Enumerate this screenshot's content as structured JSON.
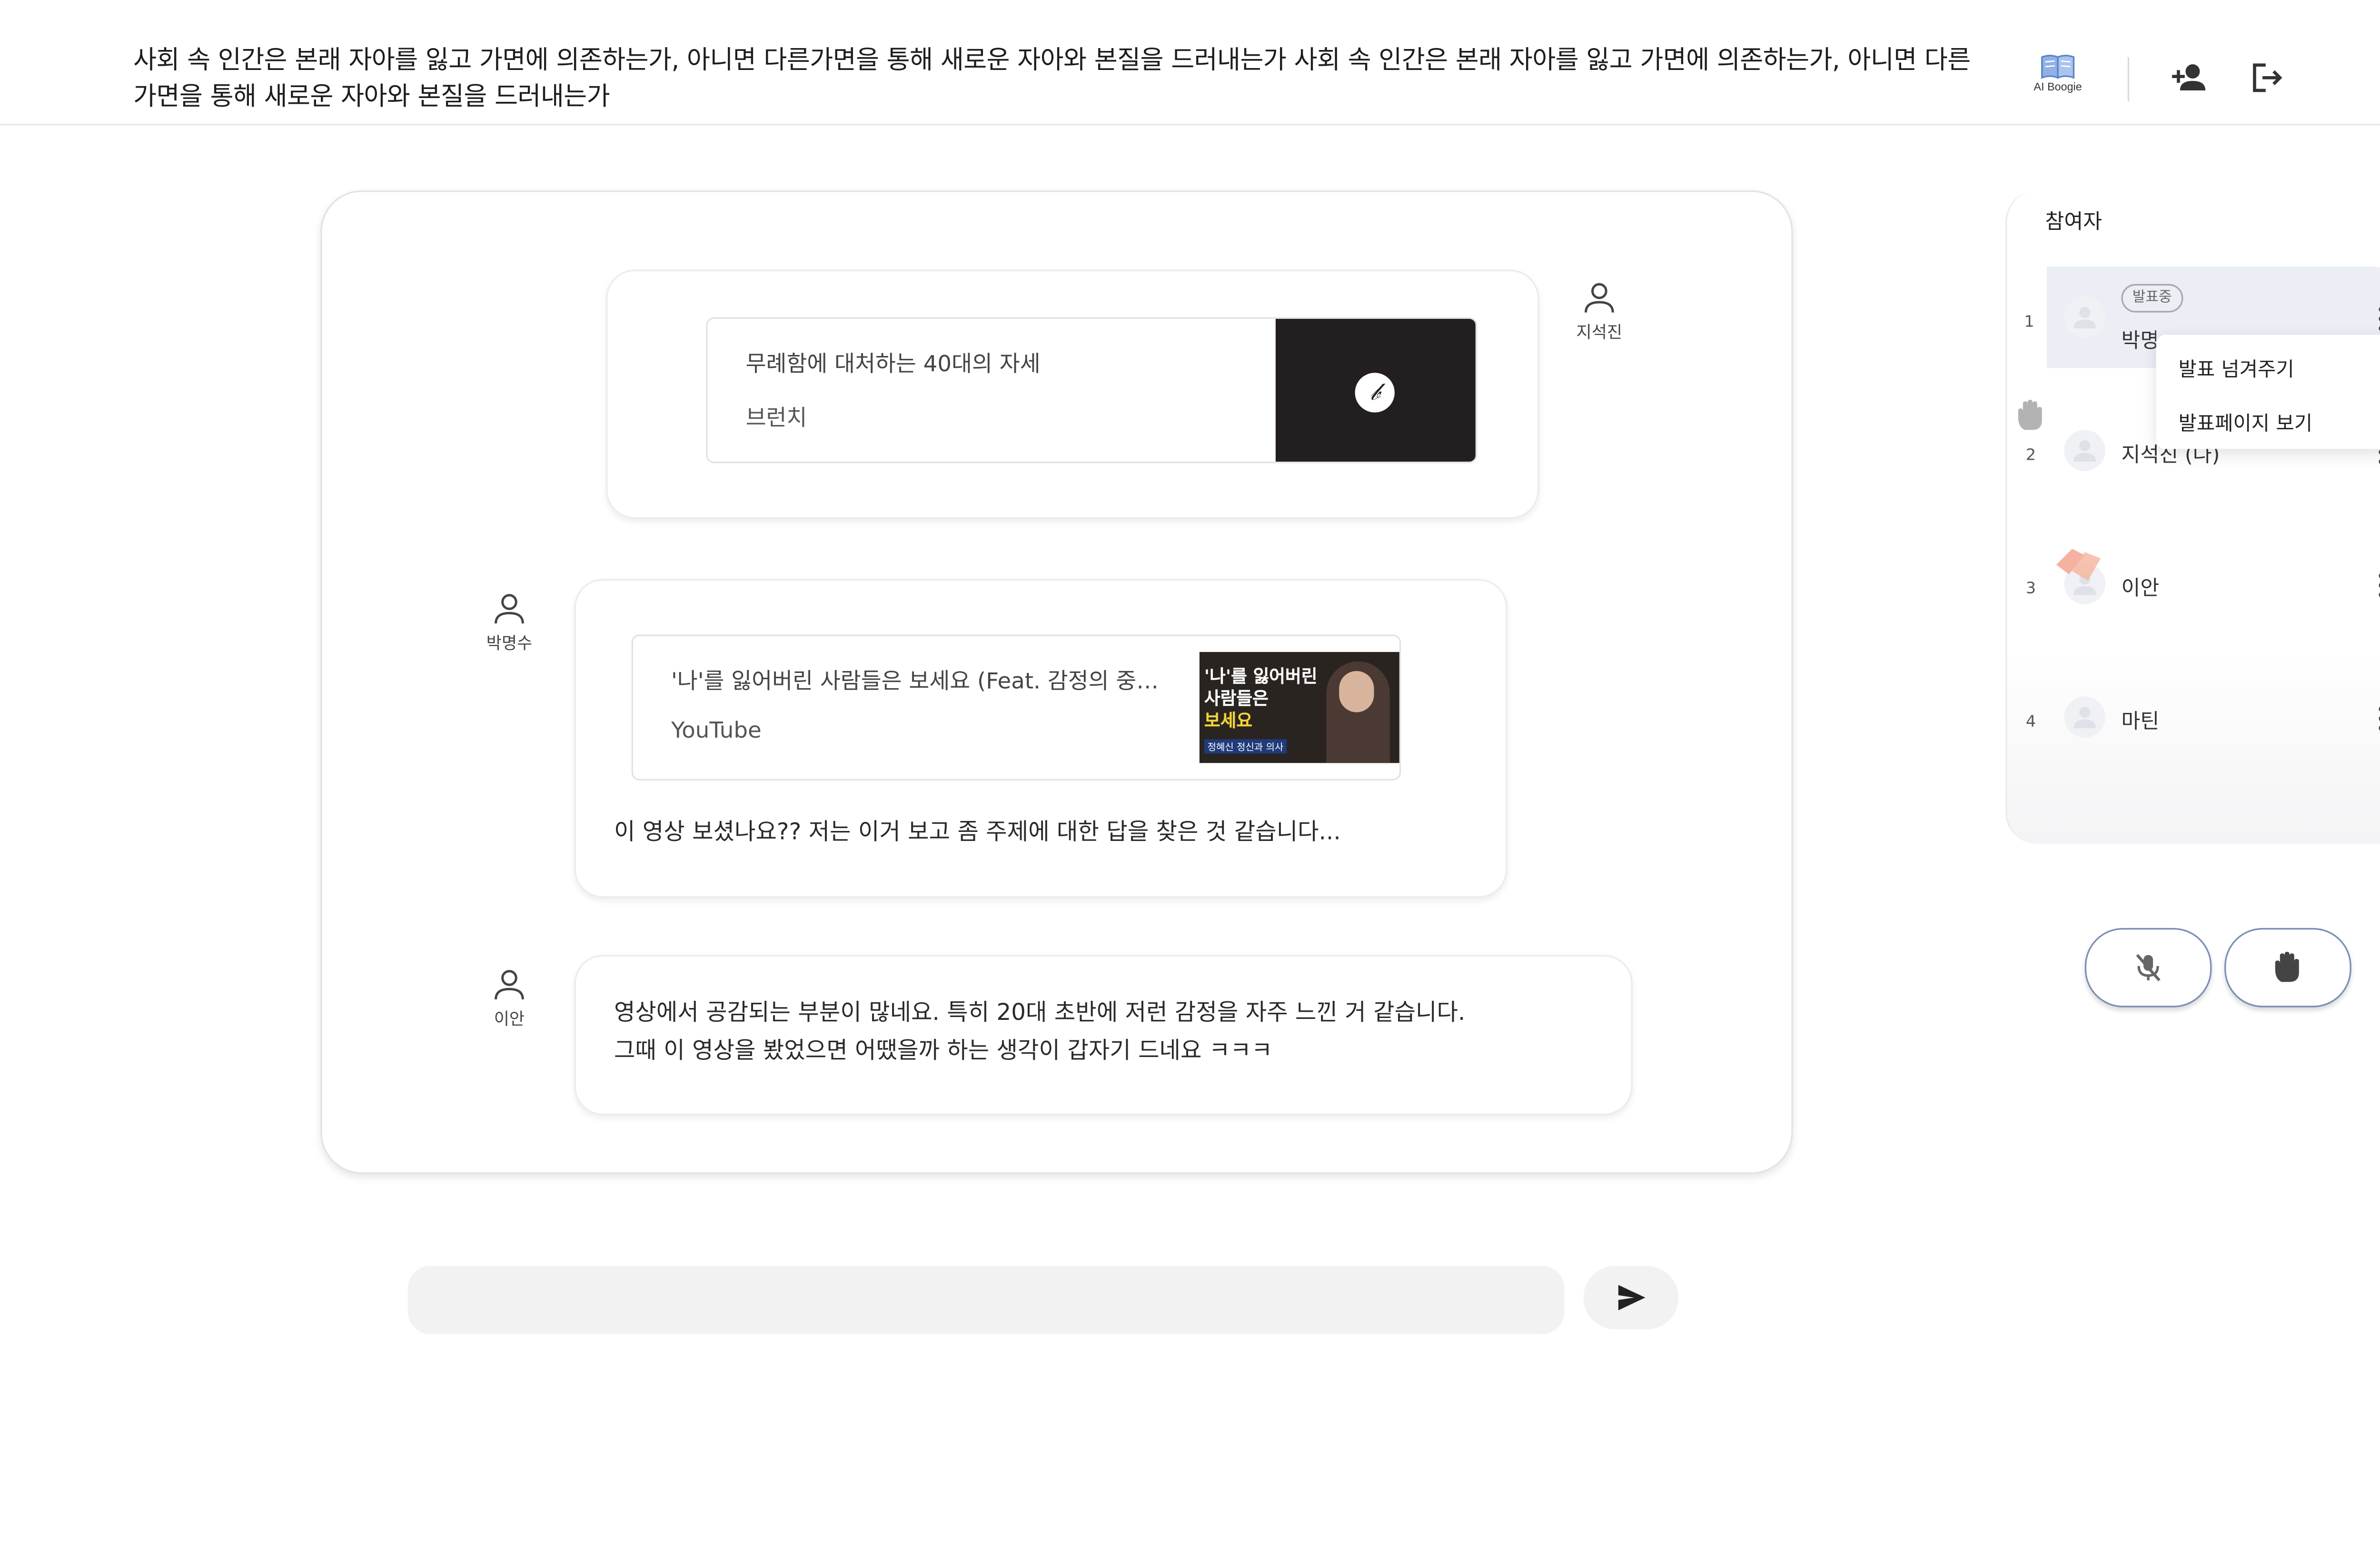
{
  "header": {
    "title": "사회 속 인간은 본래 자아를 잃고 가면에 의존하는가, 아니면 다른가면을 통해 새로운 자아와 본질을 드러내는가 사회 속 인간은 본래 자아를 잃고 가면에 의존하는가, 아니면 다른가면을 통해 새로운 자아와 본질을 드러내는가",
    "ai_label": "AI Boogie",
    "icons": [
      "book-icon",
      "add-person-icon",
      "logout-icon"
    ]
  },
  "chat": {
    "messages": [
      {
        "author": "지석진",
        "card": {
          "title": "무례함에 대처하는 40대의 자세",
          "source": "브런치",
          "thumb_glyph": "𝒷"
        }
      },
      {
        "author": "박명수",
        "card": {
          "title": "'나'를 잃어버린 사람들은 보세요 (Feat. 감정의 중…",
          "source": "YouTube",
          "thumb_line1": "'나'를 잃어버린",
          "thumb_line2": "사람들은",
          "thumb_line3": "보세요",
          "thumb_caption": "정혜신 정신과 의사"
        },
        "text": "이 영상 보셨나요?? 저는 이거 보고 좀 주제에 대한 답을 찾은 것 같습니다..."
      },
      {
        "author": "이안",
        "text_line1": "영상에서 공감되는 부분이 많네요. 특히 20대 초반에 저런 감정을 자주 느낀 거 같습니다.",
        "text_line2": "그때 이 영상을 봤었으면 어땠을까 하는 생각이 갑자기 드네요 ㅋㅋㅋ"
      }
    ]
  },
  "input": {
    "placeholder": "",
    "send_icon": "send-icon"
  },
  "participants": {
    "title": "참여자",
    "presenting_badge": "발표중",
    "items": [
      {
        "num": "1",
        "name": "박명수"
      },
      {
        "num": "2",
        "name": "지석진 (나)"
      },
      {
        "num": "3",
        "name": "이안"
      },
      {
        "num": "4",
        "name": "마틴"
      }
    ],
    "menu": [
      "발표 넘겨주기",
      "발표페이지 보기"
    ]
  },
  "controls": {
    "mic": "mic-off-icon",
    "hand": "raise-hand-icon"
  },
  "colors": {
    "accent_border": "#7b8fb4",
    "active_row": "#eceef6",
    "thumb_bg": "#231f20"
  }
}
